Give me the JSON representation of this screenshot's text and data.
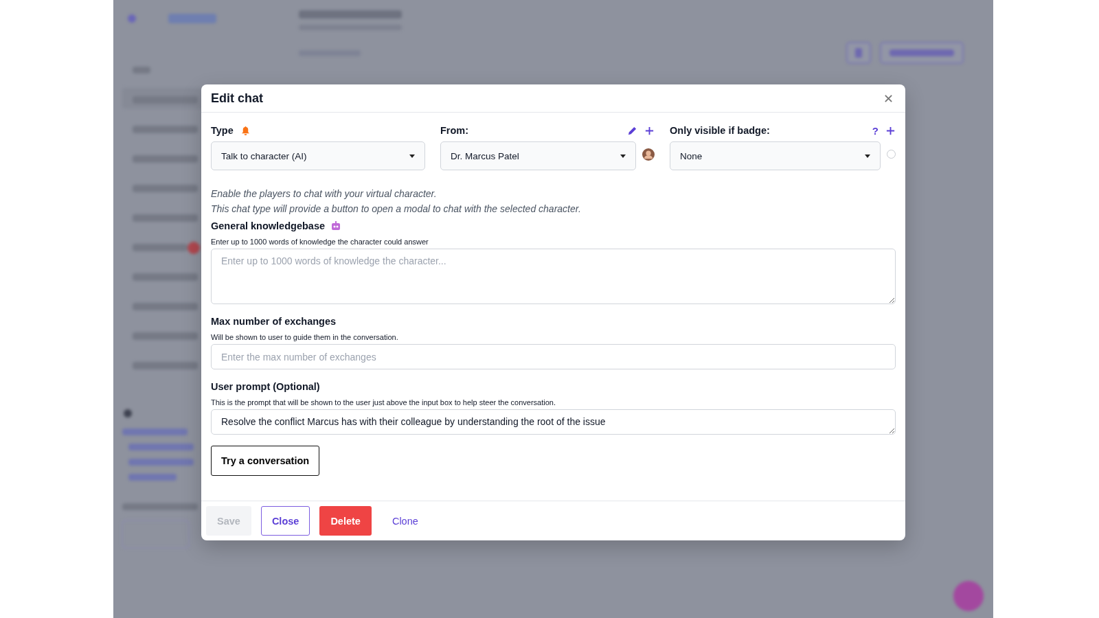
{
  "dialog": {
    "title": "Edit chat"
  },
  "type_field": {
    "label": "Type",
    "value": "Talk to character (AI)"
  },
  "from_field": {
    "label": "From:",
    "value": "Dr. Marcus Patel"
  },
  "badge_field": {
    "label": "Only visible if badge:",
    "help": "?",
    "value": "None",
    "selected": false
  },
  "description": [
    "Enable the players to chat with your virtual character.",
    "This chat type will provide a button to open a modal to chat with the selected character."
  ],
  "sections": [
    {
      "kind": "textarea",
      "title": "General knowledgebase",
      "robot": true,
      "hint": "Enter up to 1000 words of knowledge the character could answer",
      "placeholder": "Enter up to 1000 words of knowledge the character..."
    },
    {
      "kind": "input",
      "title": "Max number of exchanges",
      "robot": false,
      "hint": "Will be shown to user to guide them in the conversation.",
      "placeholder": "Enter the max number of exchanges"
    },
    {
      "kind": "textarea-small",
      "title": "User prompt (Optional)",
      "robot": false,
      "hint": "This is the prompt that will be shown to the user just above the input box to help steer the conversation.",
      "value": "Resolve the conflict Marcus has with their colleague by understanding the root of the issue"
    }
  ],
  "try_button": "Try a conversation",
  "footer_buttons": [
    {
      "label": "Save",
      "kind": "primary",
      "disabled": true
    },
    {
      "label": "Close",
      "kind": "outline",
      "disabled": false
    },
    {
      "label": "Delete",
      "kind": "danger",
      "disabled": false
    },
    {
      "label": "Clone",
      "kind": "link",
      "disabled": false
    }
  ]
}
